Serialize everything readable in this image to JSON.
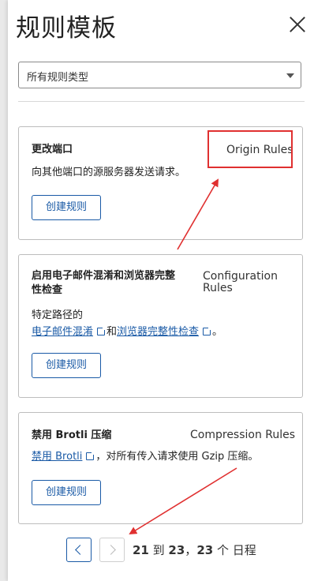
{
  "panel": {
    "title": "规则模板",
    "filter_value": "所有规则类型"
  },
  "cards": [
    {
      "title": "更改端口",
      "tag": "Origin Rules",
      "desc": "向其他端口的源服务器发送请求。",
      "button": "创建规则"
    },
    {
      "title_line1": "启用电子邮件混淆和浏览器完整",
      "title_line2": "性检查",
      "tag_line1": "Configuration",
      "tag_line2": "Rules",
      "desc_line1": "特定路径的",
      "link1": "电子邮件混淆",
      "and": "和",
      "link2": "浏览器完整性检查",
      "end": "。",
      "button": "创建规则"
    },
    {
      "title": "禁用 Brotli 压缩",
      "tag": "Compression Rules",
      "link": "禁用 Brotli",
      "desc_rest": "，对所有传入请求使用 Gzip 压缩。",
      "button": "创建规则"
    }
  ],
  "pagination": {
    "start": "21",
    "sep1": " 到 ",
    "end": "23",
    "sep2": "，",
    "total": "23",
    "suffix": " 个 日程"
  },
  "annotations": {
    "color": "#e03030"
  }
}
